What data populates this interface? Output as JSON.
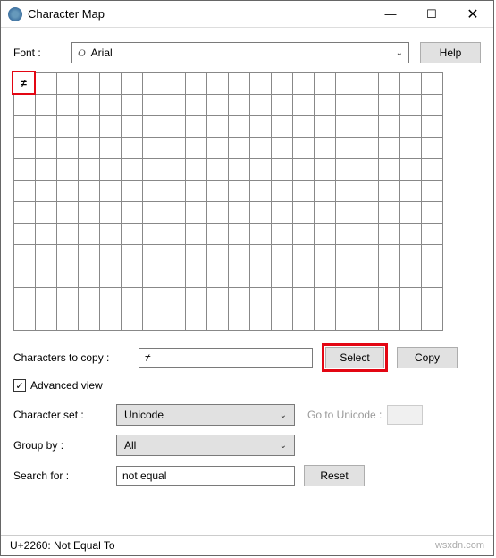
{
  "window": {
    "title": "Character Map"
  },
  "font_row": {
    "label": "Font :",
    "font_prefix": "O",
    "font_name": "Arial",
    "help_btn": "Help"
  },
  "grid": {
    "rows": 12,
    "cols": 20,
    "selected_char": "≠"
  },
  "copy_row": {
    "label": "Characters to copy :",
    "value": "≠",
    "select_btn": "Select",
    "copy_btn": "Copy"
  },
  "advanced_chk": {
    "checked": true,
    "label": "Advanced view"
  },
  "charset_row": {
    "label": "Character set :",
    "value": "Unicode",
    "goto_label": "Go to Unicode :"
  },
  "group_row": {
    "label": "Group by :",
    "value": "All"
  },
  "search_row": {
    "label": "Search for :",
    "value": "not equal",
    "reset_btn": "Reset"
  },
  "statusbar": {
    "text": "U+2260: Not Equal To",
    "watermark": "wsxdn.com"
  }
}
